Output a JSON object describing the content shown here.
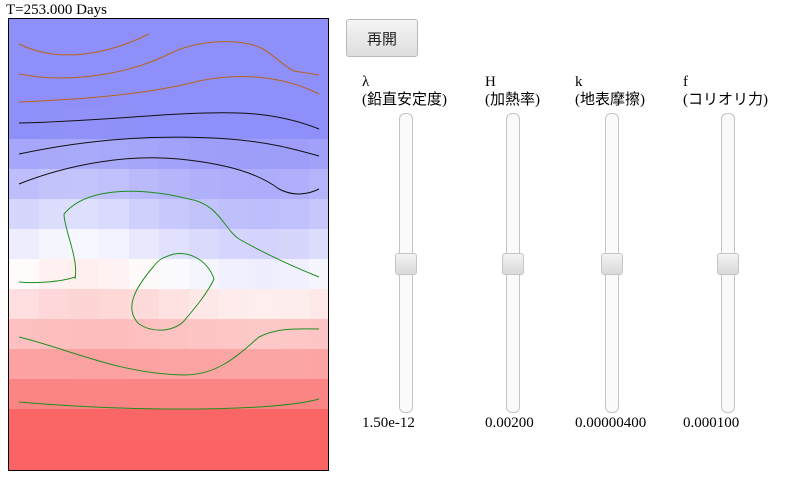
{
  "header": {
    "time_text": "T=253.000 Days"
  },
  "toolbar": {
    "resume_label": "再開"
  },
  "controls": [
    {
      "symbol": "λ",
      "description": "(鉛直安定度)",
      "value_text": "1.50e-12",
      "level": 0.5
    },
    {
      "symbol": "H",
      "description": "(加熱率)",
      "value_text": "0.00200",
      "level": 0.5
    },
    {
      "symbol": "k",
      "description": "(地表摩擦)",
      "value_text": "0.00000400",
      "level": 0.5
    },
    {
      "symbol": "f",
      "description": "(コリオリ力)",
      "value_text": "0.000100",
      "level": 0.5
    }
  ],
  "colors": {
    "cold": "#8f8ff9",
    "neutral": "#ffffff",
    "warm": "#fa6464",
    "contour_upper": "#b5651d",
    "contour_middle": "#101010",
    "contour_lower": "#1f8f1f"
  }
}
